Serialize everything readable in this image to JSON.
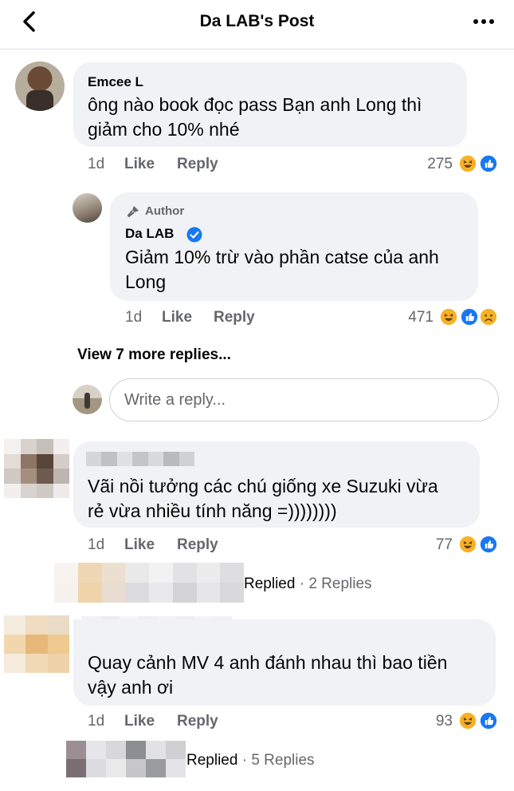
{
  "header": {
    "title": "Da LAB's Post"
  },
  "comments": [
    {
      "name": "Emcee L",
      "lines": [
        "ông nào book đọc pass Bạn anh Long thì",
        "giảm cho 10% nhé"
      ],
      "time": "1d",
      "like": "Like",
      "reply": "Reply",
      "reaction_count": "275"
    },
    {
      "badge": "Author",
      "name": "Da LAB",
      "lines": [
        "Giảm 10% trừ vào phần catse của anh",
        "Long"
      ],
      "time": "1d",
      "like": "Like",
      "reply": "Reply",
      "reaction_count": "471"
    },
    {
      "lines": [
        "Vãi nồi tưởng các chú giống xe Suzuki vừa",
        "rẻ vừa nhiều tính năng =))))))))"
      ],
      "time": "1d",
      "like": "Like",
      "reply": "Reply",
      "reaction_count": "77"
    },
    {
      "lines": [
        "Quay cảnh MV 4 anh đánh nhau thì bao tiền",
        "vậy anh ơi"
      ],
      "time": "1d",
      "like": "Like",
      "reply": "Reply",
      "reaction_count": "93"
    }
  ],
  "view_more": "View 7 more replies...",
  "reply_box": {
    "placeholder": "Write a reply..."
  },
  "replied_threads": [
    {
      "label": "Replied",
      "sep": "·",
      "count": "2 Replies"
    },
    {
      "label": "Replied",
      "sep": "·",
      "count": "5 Replies"
    }
  ],
  "colors": {
    "like_blue": "#1877f2",
    "haha_yellow": "#f7b125",
    "verified_blue": "#1877f2",
    "muted_text": "#65676b",
    "bubble": "#f0f2f5"
  }
}
